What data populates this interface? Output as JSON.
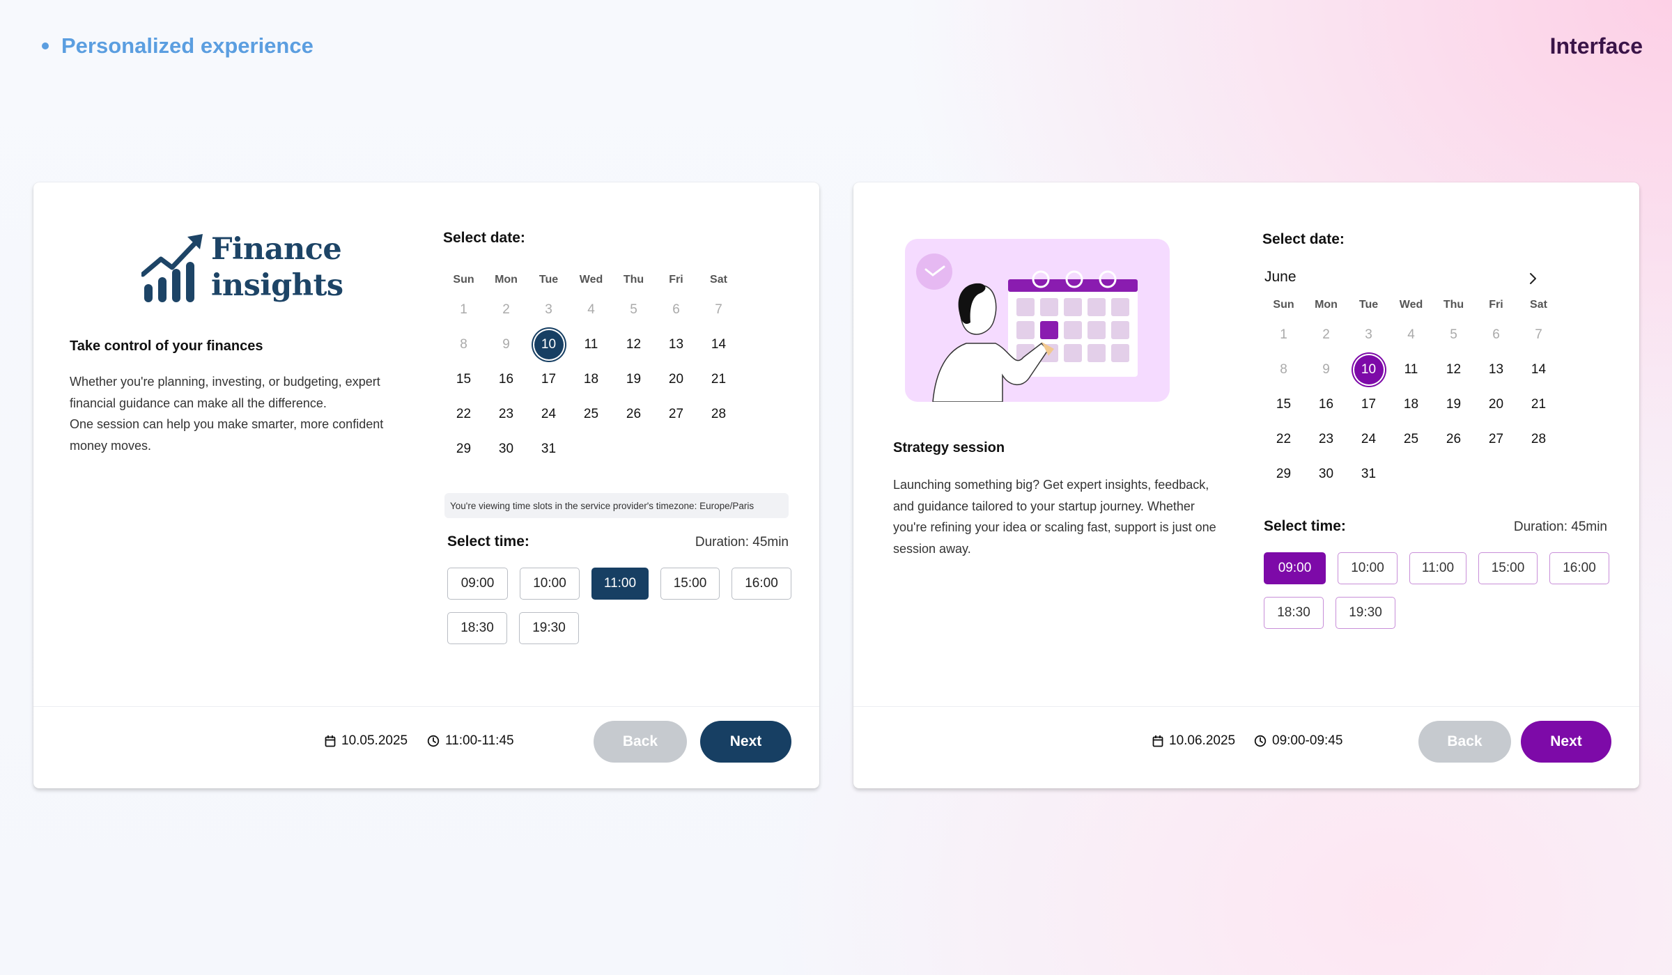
{
  "header": {
    "tag": "Personalized experience",
    "title": "Interface"
  },
  "colors": {
    "finance_accent": "#173f63",
    "strategy_accent": "#7d0aa8",
    "tag_blue": "#5b9ee0"
  },
  "left_card": {
    "logo_line1": "Finance",
    "logo_line2": "insights",
    "title": "Take control of your finances",
    "description_p1": "Whether you're planning, investing, or budgeting, expert financial guidance can make all the difference.",
    "description_p2": "One session can help you make smarter, more confident money moves.",
    "select_date_label": "Select date:",
    "day_headers": [
      "Sun",
      "Mon",
      "Tue",
      "Wed",
      "Thu",
      "Fri",
      "Sat"
    ],
    "days": [
      [
        "1",
        "2",
        "3",
        "4",
        "5",
        "6",
        "7"
      ],
      [
        "8",
        "9",
        "10",
        "11",
        "12",
        "13",
        "14"
      ],
      [
        "15",
        "16",
        "17",
        "18",
        "19",
        "20",
        "21"
      ],
      [
        "22",
        "23",
        "24",
        "25",
        "26",
        "27",
        "28"
      ],
      [
        "29",
        "30",
        "31"
      ]
    ],
    "selected_day": "10",
    "disabled_days": [
      "1",
      "2",
      "3",
      "4",
      "5",
      "6",
      "7",
      "8",
      "9"
    ],
    "timezone_note": "You're viewing time slots in the service provider's timezone: Europe/Paris",
    "select_time_label": "Select time:",
    "duration": "Duration: 45min",
    "time_slots": [
      "09:00",
      "10:00",
      "11:00",
      "15:00",
      "16:00",
      "18:30",
      "19:30"
    ],
    "selected_slot": "11:00",
    "summary_date": "10.05.2025",
    "summary_time": "11:00-11:45",
    "back_label": "Back",
    "next_label": "Next"
  },
  "right_card": {
    "title": "Strategy session",
    "description": "Launching something big? Get expert insights, feedback, and guidance tailored to your startup journey. Whether you're refining your idea or scaling fast, support is just one session away.",
    "select_date_label": "Select date:",
    "month": "June",
    "day_headers": [
      "Sun",
      "Mon",
      "Tue",
      "Wed",
      "Thu",
      "Fri",
      "Sat"
    ],
    "days": [
      [
        "1",
        "2",
        "3",
        "4",
        "5",
        "6",
        "7"
      ],
      [
        "8",
        "9",
        "10",
        "11",
        "12",
        "13",
        "14"
      ],
      [
        "15",
        "16",
        "17",
        "18",
        "19",
        "20",
        "21"
      ],
      [
        "22",
        "23",
        "24",
        "25",
        "26",
        "27",
        "28"
      ],
      [
        "29",
        "30",
        "31"
      ]
    ],
    "selected_day": "10",
    "disabled_days": [
      "1",
      "2",
      "3",
      "4",
      "5",
      "6",
      "7",
      "8",
      "9"
    ],
    "select_time_label": "Select time:",
    "duration": "Duration: 45min",
    "time_slots": [
      "09:00",
      "10:00",
      "11:00",
      "15:00",
      "16:00",
      "18:30",
      "19:30"
    ],
    "selected_slot": "09:00",
    "summary_date": "10.06.2025",
    "summary_time": "09:00-09:45",
    "back_label": "Back",
    "next_label": "Next"
  }
}
